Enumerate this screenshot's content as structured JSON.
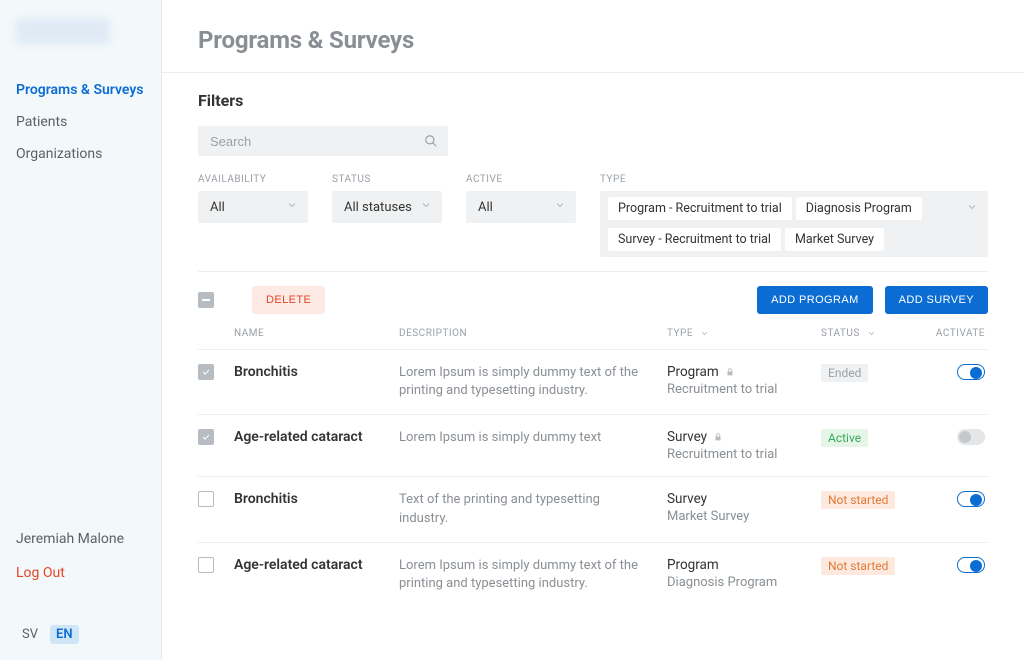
{
  "sidebar": {
    "nav": [
      {
        "label": "Programs & Surveys",
        "active": true
      },
      {
        "label": "Patients",
        "active": false
      },
      {
        "label": "Organizations",
        "active": false
      }
    ],
    "user_name": "Jeremiah Malone",
    "logout_label": "Log Out",
    "languages": [
      {
        "code": "SV",
        "active": false
      },
      {
        "code": "EN",
        "active": true
      }
    ]
  },
  "header": {
    "page_title": "Programs & Surveys"
  },
  "filters": {
    "section_title": "Filters",
    "search_placeholder": "Search",
    "availability": {
      "label": "AVAILABILITY",
      "value": "All"
    },
    "status": {
      "label": "STATUS",
      "value": "All statuses"
    },
    "active": {
      "label": "ACTIVE",
      "value": "All"
    },
    "type": {
      "label": "TYPE",
      "tags": [
        "Program - Recruitment to trial",
        "Diagnosis Program",
        "Survey - Recruitment to trial",
        "Market Survey"
      ]
    }
  },
  "toolbar": {
    "master_checkbox_state": "indeterminate",
    "delete_label": "DELETE",
    "add_program_label": "ADD PROGRAM",
    "add_survey_label": "ADD SURVEY"
  },
  "table": {
    "columns": {
      "name": "NAME",
      "description": "DESCRIPTION",
      "type": "TYPE",
      "status": "STATUS",
      "activate": "ACTIVATE"
    },
    "rows": [
      {
        "checked": true,
        "name": "Bronchitis",
        "description": "Lorem Ipsum is simply dummy text of the printing and typesetting industry.",
        "type_main": "Program",
        "locked": true,
        "type_sub": "Recruitment to trial",
        "status_label": "Ended",
        "status_kind": "ended",
        "activate_on": true
      },
      {
        "checked": true,
        "name": "Age-related cataract",
        "description": "Lorem Ipsum is simply dummy text",
        "type_main": "Survey",
        "locked": true,
        "type_sub": "Recruitment to trial",
        "status_label": "Active",
        "status_kind": "active",
        "activate_on": false
      },
      {
        "checked": false,
        "name": "Bronchitis",
        "description": "Text of the printing and typesetting industry.",
        "type_main": "Survey",
        "locked": false,
        "type_sub": "Market Survey",
        "status_label": "Not started",
        "status_kind": "notstarted",
        "activate_on": true
      },
      {
        "checked": false,
        "name": "Age-related cataract",
        "description": "Lorem Ipsum is simply dummy text of the printing and typesetting industry.",
        "type_main": "Program",
        "locked": false,
        "type_sub": "Diagnosis Program",
        "status_label": "Not started",
        "status_kind": "notstarted",
        "activate_on": true
      }
    ]
  }
}
